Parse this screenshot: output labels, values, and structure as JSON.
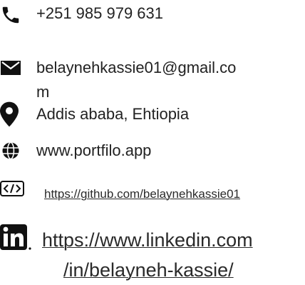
{
  "contacts": {
    "phone": "+251 985 979 631",
    "email_line1": "belaynehkassie01@gmail.co",
    "email_line2": "m",
    "location": "Addis ababa, Ehtiopia",
    "website": "www.portfilo.app",
    "github": "https://github.com/belaynehkassie01",
    "linkedin_line1": "https://www.linkedin.com",
    "linkedin_line2": "/in/belayneh-kassie/"
  },
  "icons": {
    "phone": "phone-icon",
    "email": "envelope-icon",
    "location": "map-pin-icon",
    "website": "globe-icon",
    "github": "code-icon",
    "linkedin": "linkedin-icon"
  },
  "colors": {
    "text": "#222222",
    "icon": "#111111",
    "link": "#2a2a2a"
  }
}
